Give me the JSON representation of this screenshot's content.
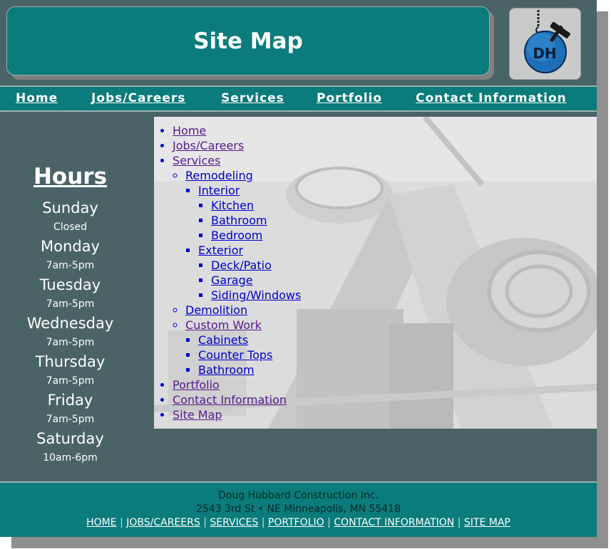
{
  "header": {
    "title": "Site Map",
    "logo_text": "DH"
  },
  "nav": [
    {
      "label": "Home"
    },
    {
      "label": "Jobs/Careers"
    },
    {
      "label": "Services"
    },
    {
      "label": "Portfolio"
    },
    {
      "label": "Contact Information"
    }
  ],
  "hours": {
    "title": "Hours",
    "days": [
      {
        "day": "Sunday",
        "time": "Closed"
      },
      {
        "day": "Monday",
        "time": "7am-5pm"
      },
      {
        "day": "Tuesday",
        "time": "7am-5pm"
      },
      {
        "day": "Wednesday",
        "time": "7am-5pm"
      },
      {
        "day": "Thursday",
        "time": "7am-5pm"
      },
      {
        "day": "Friday",
        "time": "7am-5pm"
      },
      {
        "day": "Saturday",
        "time": "10am-6pm"
      }
    ]
  },
  "sitemap": {
    "home": "Home",
    "jobs": "Jobs/Careers",
    "services": "Services",
    "remodeling": "Remodeling",
    "interior": "Interior",
    "kitchen": "Kitchen",
    "bathroom": "Bathroom",
    "bedroom": "Bedroom",
    "exterior": "Exterior",
    "deck": "Deck/Patio",
    "garage": "Garage",
    "siding": "Siding/Windows",
    "demolition": "Demolition",
    "custom": "Custom Work",
    "cabinets": "Cabinets",
    "counter": "Counter Tops",
    "custom_bathroom": "Bathroom",
    "portfolio": "Portfolio",
    "contact": "Contact Information",
    "sitemap": "Site Map"
  },
  "footer": {
    "company": "Doug Hubbard Construction Inc.",
    "address": "2543 3rd St • NE Minneapolis, MN 55418",
    "links": [
      "HOME",
      "JOBS/CAREERS",
      "SERVICES",
      "PORTFOLIO",
      "CONTACT INFORMATION",
      "SITE MAP"
    ],
    "separator": "|"
  },
  "colors": {
    "teal": "#0b7b7b",
    "slate": "#4a6366",
    "link": "#0000cc",
    "visited": "#551a8b"
  }
}
